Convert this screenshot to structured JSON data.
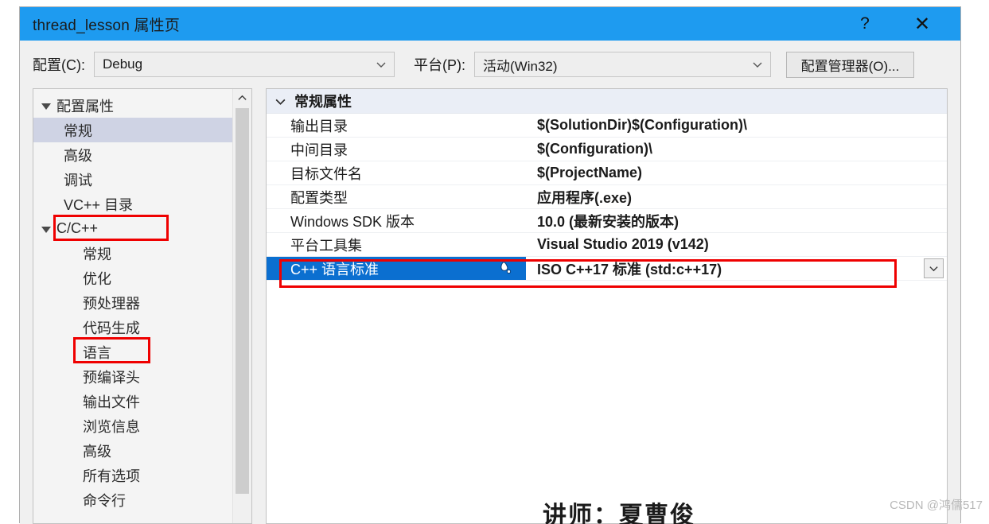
{
  "window": {
    "title": "thread_lesson 属性页",
    "help_label": "?",
    "close_label": "✕",
    "titlebar_color": "#1e9bf0"
  },
  "toolbar": {
    "config_label": "配置(C):",
    "config_value": "Debug",
    "platform_label": "平台(P):",
    "platform_value": "活动(Win32)",
    "config_manager_label": "配置管理器(O)..."
  },
  "tree": {
    "items": [
      {
        "label": "配置属性",
        "level": 0,
        "expander": "expanded",
        "selected": false
      },
      {
        "label": "常规",
        "level": 1,
        "expander": "none",
        "selected": true
      },
      {
        "label": "高级",
        "level": 1,
        "expander": "none",
        "selected": false
      },
      {
        "label": "调试",
        "level": 1,
        "expander": "none",
        "selected": false
      },
      {
        "label": "VC++ 目录",
        "level": 1,
        "expander": "none",
        "selected": false
      },
      {
        "label": "C/C++",
        "level": 0,
        "expander": "expanded",
        "selected": false,
        "highlight": "red-box"
      },
      {
        "label": "常规",
        "level": 2,
        "expander": "none",
        "selected": false
      },
      {
        "label": "优化",
        "level": 2,
        "expander": "none",
        "selected": false
      },
      {
        "label": "预处理器",
        "level": 2,
        "expander": "none",
        "selected": false
      },
      {
        "label": "代码生成",
        "level": 2,
        "expander": "none",
        "selected": false
      },
      {
        "label": "语言",
        "level": 2,
        "expander": "none",
        "selected": false,
        "highlight": "red-box"
      },
      {
        "label": "预编译头",
        "level": 2,
        "expander": "none",
        "selected": false
      },
      {
        "label": "输出文件",
        "level": 2,
        "expander": "none",
        "selected": false
      },
      {
        "label": "浏览信息",
        "level": 2,
        "expander": "none",
        "selected": false
      },
      {
        "label": "高级",
        "level": 2,
        "expander": "none",
        "selected": false
      },
      {
        "label": "所有选项",
        "level": 2,
        "expander": "none",
        "selected": false
      },
      {
        "label": "命令行",
        "level": 2,
        "expander": "none",
        "selected": false
      }
    ]
  },
  "grid": {
    "group_header": "常规属性",
    "rows": [
      {
        "name": "输出目录",
        "value": "$(SolutionDir)$(Configuration)\\",
        "selected": false
      },
      {
        "name": "中间目录",
        "value": "$(Configuration)\\",
        "selected": false
      },
      {
        "name": "目标文件名",
        "value": "$(ProjectName)",
        "selected": false
      },
      {
        "name": "配置类型",
        "value": "应用程序(.exe)",
        "selected": false
      },
      {
        "name": "Windows SDK 版本",
        "value": "10.0 (最新安装的版本)",
        "selected": false
      },
      {
        "name": "平台工具集",
        "value": "Visual Studio 2019 (v142)",
        "selected": false
      },
      {
        "name": "C++ 语言标准",
        "value": "ISO C++17 标准 (std:c++17)",
        "selected": true
      }
    ]
  },
  "overlay": {
    "bottom_text": "讲师：夏曹俊",
    "watermark": "CSDN @鸿儒517"
  }
}
